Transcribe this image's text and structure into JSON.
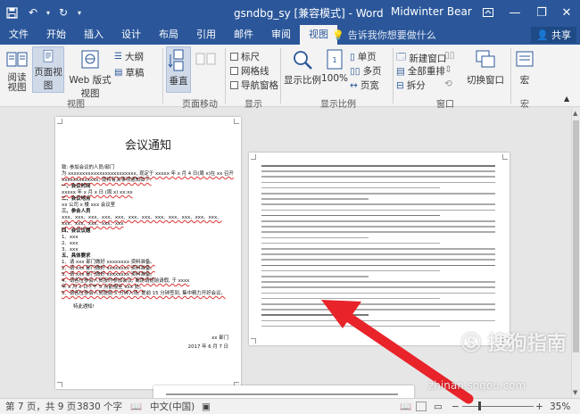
{
  "titlebar": {
    "document_title": "gsndbg_sy [兼容模式] - Word",
    "user_name": "Midwinter Bear"
  },
  "tabs": [
    "文件",
    "开始",
    "插入",
    "设计",
    "布局",
    "引用",
    "邮件",
    "审阅",
    "视图"
  ],
  "active_tab": "视图",
  "tell_me": "告诉我你想要做什么",
  "share_label": "共享",
  "ribbon": {
    "views": {
      "read_mode": "阅读视图",
      "print_layout": "页面视图",
      "web_layout": "Web 版式视图",
      "outline": "大纲",
      "draft": "草稿",
      "group_label": "视图"
    },
    "page_movement": {
      "vertical": "垂直",
      "group_label": "页面移动"
    },
    "show": {
      "ruler": "标尺",
      "gridlines": "网格线",
      "nav_pane": "导航窗格",
      "group_label": "显示"
    },
    "zoom": {
      "zoom": "显示比例",
      "hundred": "100%",
      "one_page": "单页",
      "multi_page": "多页",
      "page_width": "页宽",
      "group_label": "显示比例"
    },
    "window": {
      "new_window": "新建窗口",
      "arrange_all": "全部重排",
      "split": "拆分",
      "switch_windows": "切换窗口",
      "group_label": "窗口"
    },
    "macros": {
      "macros": "宏",
      "group_label": "宏"
    }
  },
  "page1": {
    "title": "会议通知",
    "lines": [
      "致: 参加会议的人员/部门",
      "为 xxxxxxxxxxxxxxxxxxxxxxxx, 现定于 xxxxx 年 x 月 4 日(周 x)在 xx 召开",
      "xxxxxxxxxxxxx, 现将有关事项通知如下:",
      "一、会议时间",
      "xxxxx 年 x 月 x 日 (周 x) xx:xx",
      "二、会议地点",
      "xx 公司 x 楼 xxx 会议室",
      "三、参会人员",
      "xxx、xxx、xxx、xxx、xxx、xxx、xxx、xxx、xxx、xxx、xxx、xxx、",
      "xxx、xxx、xxx、xxx、xxx",
      "四、会议议题",
      "1、xxx",
      "2、xxx",
      "3、xxx",
      "五、具体要求",
      "1、请 xxx 部门做好 xxxxxxxx 资料准备。",
      "2、请 xxx 部门做好 xxxxxxxx 资料准备。",
      "3、请 xxx 部门做好 xxxxxxxx 资料准备。",
      "4、请各位参会人员按时参加会议, 离席请提前请假, 于 xxxx",
      "年 x 月 x 日下午 5 点前报至 xxx 处。",
      "5、请各位参会人员提前 5 分钟入场, 提前 15 分钟签到, 集中精力开好会议。",
      "特此通知!",
      "xx 部门",
      "2017 年 6 月 7 日"
    ]
  },
  "status": {
    "page_info": "第 7 页，共 9 页",
    "word_count": "3830 个字",
    "language": "中文(中国)",
    "zoom_percent": "35%"
  },
  "watermark": {
    "brand": "搜狗指南",
    "site": "zhinan.sogou.com"
  },
  "colors": {
    "accent": "#2b579a",
    "arrow": "#e8232a"
  }
}
